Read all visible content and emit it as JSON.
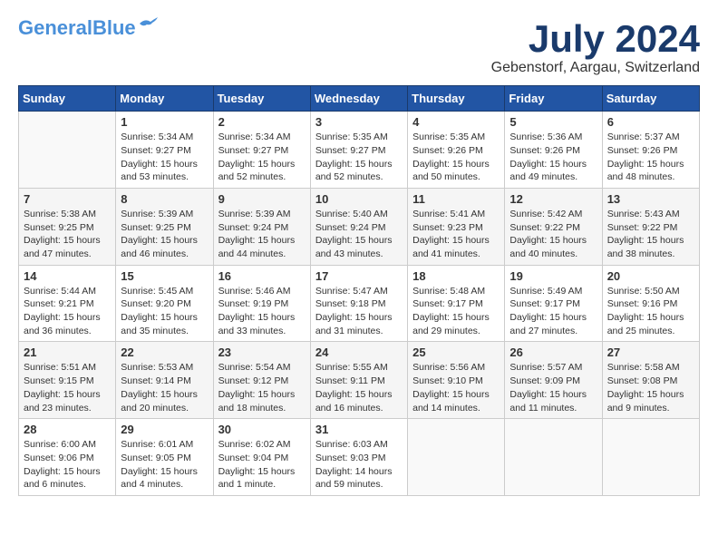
{
  "header": {
    "logo_general": "General",
    "logo_blue": "Blue",
    "month_year": "July 2024",
    "location": "Gebenstorf, Aargau, Switzerland"
  },
  "calendar": {
    "headers": [
      "Sunday",
      "Monday",
      "Tuesday",
      "Wednesday",
      "Thursday",
      "Friday",
      "Saturday"
    ],
    "weeks": [
      [
        {
          "day": "",
          "info": ""
        },
        {
          "day": "1",
          "info": "Sunrise: 5:34 AM\nSunset: 9:27 PM\nDaylight: 15 hours\nand 53 minutes."
        },
        {
          "day": "2",
          "info": "Sunrise: 5:34 AM\nSunset: 9:27 PM\nDaylight: 15 hours\nand 52 minutes."
        },
        {
          "day": "3",
          "info": "Sunrise: 5:35 AM\nSunset: 9:27 PM\nDaylight: 15 hours\nand 52 minutes."
        },
        {
          "day": "4",
          "info": "Sunrise: 5:35 AM\nSunset: 9:26 PM\nDaylight: 15 hours\nand 50 minutes."
        },
        {
          "day": "5",
          "info": "Sunrise: 5:36 AM\nSunset: 9:26 PM\nDaylight: 15 hours\nand 49 minutes."
        },
        {
          "day": "6",
          "info": "Sunrise: 5:37 AM\nSunset: 9:26 PM\nDaylight: 15 hours\nand 48 minutes."
        }
      ],
      [
        {
          "day": "7",
          "info": "Sunrise: 5:38 AM\nSunset: 9:25 PM\nDaylight: 15 hours\nand 47 minutes."
        },
        {
          "day": "8",
          "info": "Sunrise: 5:39 AM\nSunset: 9:25 PM\nDaylight: 15 hours\nand 46 minutes."
        },
        {
          "day": "9",
          "info": "Sunrise: 5:39 AM\nSunset: 9:24 PM\nDaylight: 15 hours\nand 44 minutes."
        },
        {
          "day": "10",
          "info": "Sunrise: 5:40 AM\nSunset: 9:24 PM\nDaylight: 15 hours\nand 43 minutes."
        },
        {
          "day": "11",
          "info": "Sunrise: 5:41 AM\nSunset: 9:23 PM\nDaylight: 15 hours\nand 41 minutes."
        },
        {
          "day": "12",
          "info": "Sunrise: 5:42 AM\nSunset: 9:22 PM\nDaylight: 15 hours\nand 40 minutes."
        },
        {
          "day": "13",
          "info": "Sunrise: 5:43 AM\nSunset: 9:22 PM\nDaylight: 15 hours\nand 38 minutes."
        }
      ],
      [
        {
          "day": "14",
          "info": "Sunrise: 5:44 AM\nSunset: 9:21 PM\nDaylight: 15 hours\nand 36 minutes."
        },
        {
          "day": "15",
          "info": "Sunrise: 5:45 AM\nSunset: 9:20 PM\nDaylight: 15 hours\nand 35 minutes."
        },
        {
          "day": "16",
          "info": "Sunrise: 5:46 AM\nSunset: 9:19 PM\nDaylight: 15 hours\nand 33 minutes."
        },
        {
          "day": "17",
          "info": "Sunrise: 5:47 AM\nSunset: 9:18 PM\nDaylight: 15 hours\nand 31 minutes."
        },
        {
          "day": "18",
          "info": "Sunrise: 5:48 AM\nSunset: 9:17 PM\nDaylight: 15 hours\nand 29 minutes."
        },
        {
          "day": "19",
          "info": "Sunrise: 5:49 AM\nSunset: 9:17 PM\nDaylight: 15 hours\nand 27 minutes."
        },
        {
          "day": "20",
          "info": "Sunrise: 5:50 AM\nSunset: 9:16 PM\nDaylight: 15 hours\nand 25 minutes."
        }
      ],
      [
        {
          "day": "21",
          "info": "Sunrise: 5:51 AM\nSunset: 9:15 PM\nDaylight: 15 hours\nand 23 minutes."
        },
        {
          "day": "22",
          "info": "Sunrise: 5:53 AM\nSunset: 9:14 PM\nDaylight: 15 hours\nand 20 minutes."
        },
        {
          "day": "23",
          "info": "Sunrise: 5:54 AM\nSunset: 9:12 PM\nDaylight: 15 hours\nand 18 minutes."
        },
        {
          "day": "24",
          "info": "Sunrise: 5:55 AM\nSunset: 9:11 PM\nDaylight: 15 hours\nand 16 minutes."
        },
        {
          "day": "25",
          "info": "Sunrise: 5:56 AM\nSunset: 9:10 PM\nDaylight: 15 hours\nand 14 minutes."
        },
        {
          "day": "26",
          "info": "Sunrise: 5:57 AM\nSunset: 9:09 PM\nDaylight: 15 hours\nand 11 minutes."
        },
        {
          "day": "27",
          "info": "Sunrise: 5:58 AM\nSunset: 9:08 PM\nDaylight: 15 hours\nand 9 minutes."
        }
      ],
      [
        {
          "day": "28",
          "info": "Sunrise: 6:00 AM\nSunset: 9:06 PM\nDaylight: 15 hours\nand 6 minutes."
        },
        {
          "day": "29",
          "info": "Sunrise: 6:01 AM\nSunset: 9:05 PM\nDaylight: 15 hours\nand 4 minutes."
        },
        {
          "day": "30",
          "info": "Sunrise: 6:02 AM\nSunset: 9:04 PM\nDaylight: 15 hours\nand 1 minute."
        },
        {
          "day": "31",
          "info": "Sunrise: 6:03 AM\nSunset: 9:03 PM\nDaylight: 14 hours\nand 59 minutes."
        },
        {
          "day": "",
          "info": ""
        },
        {
          "day": "",
          "info": ""
        },
        {
          "day": "",
          "info": ""
        }
      ]
    ]
  }
}
